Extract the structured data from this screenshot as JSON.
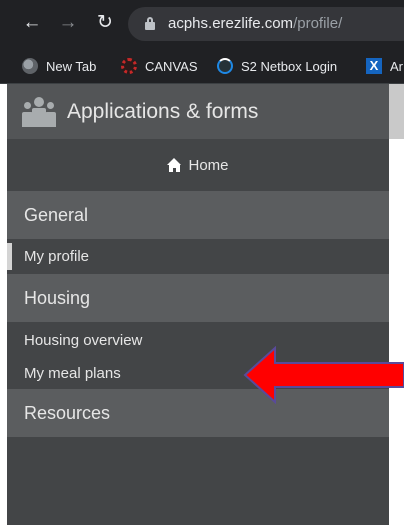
{
  "browser": {
    "url_host": "acphs.erezlife.com",
    "url_path": "/profile/",
    "nav_icons": [
      "back-arrow-icon",
      "forward-arrow-icon",
      "reload-icon",
      "lock-icon"
    ],
    "bookmarks": [
      {
        "label": "New Tab",
        "icon": "globe-icon"
      },
      {
        "label": "CANVAS",
        "icon": "canvas-icon"
      },
      {
        "label": "S2 Netbox Login",
        "icon": "netbox-icon"
      },
      {
        "label": "Ar",
        "icon": "x-icon"
      }
    ]
  },
  "sidebar": {
    "app_title": "Applications & forms",
    "home_label": "Home",
    "sections": [
      {
        "label": "General",
        "items": [
          "My profile"
        ]
      },
      {
        "label": "Housing",
        "items": [
          "Housing overview",
          "My meal plans"
        ]
      },
      {
        "label": "Resources",
        "items": []
      }
    ]
  },
  "annotation": {
    "type": "red-arrow",
    "color": "#ff0000",
    "outline": "#5a4a9a",
    "points_to": "My meal plans"
  },
  "colors": {
    "sidebar_bg": "#434547",
    "section_bg": "#5b5d5f",
    "title_bg": "#535557",
    "chrome_bg": "#202124"
  }
}
